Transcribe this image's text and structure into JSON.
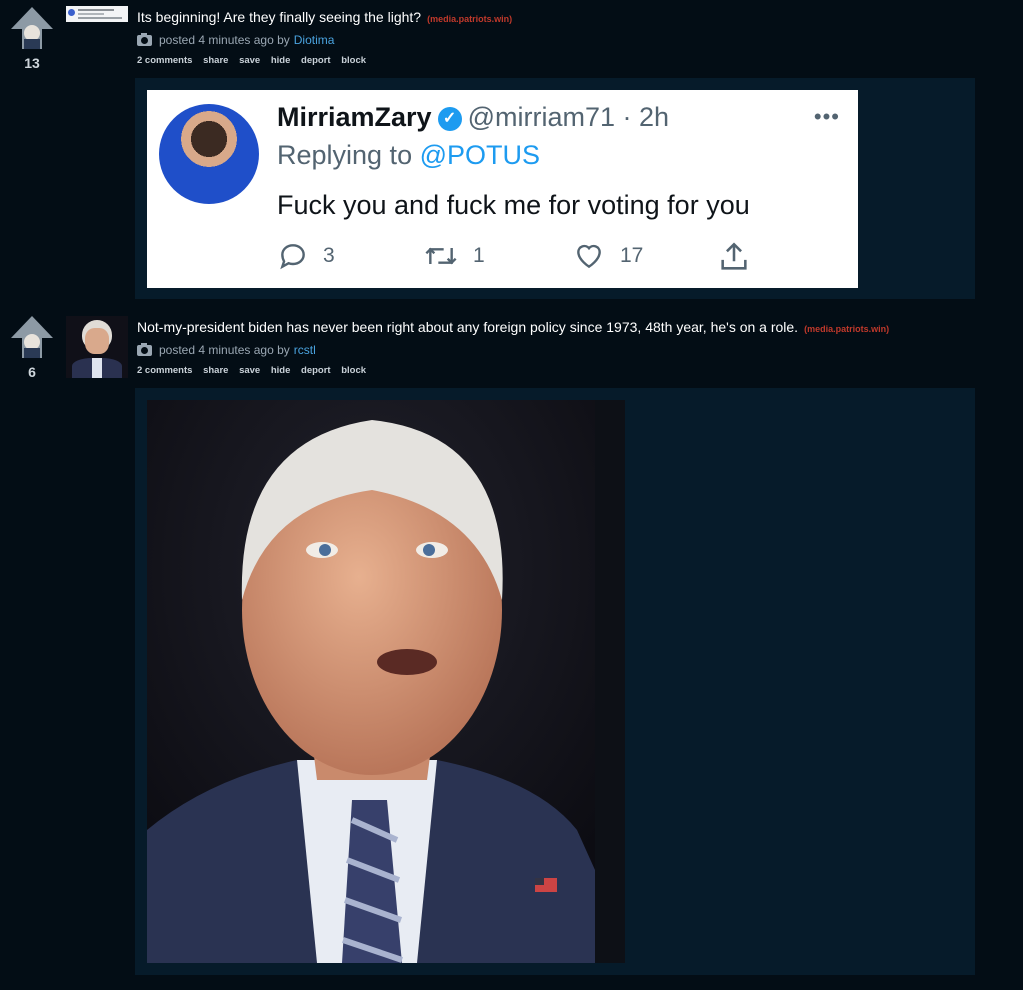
{
  "posts": [
    {
      "score": "13",
      "title": "Its beginning! Are they finally seeing the light?",
      "domain": "(media.patriots.win)",
      "posted": "posted 4 minutes ago by",
      "author": "Diotima",
      "actions": [
        "2 comments",
        "share",
        "save",
        "hide",
        "deport",
        "block"
      ],
      "tweet": {
        "name": "MirriamZary",
        "verified_icon": "verified-check-icon",
        "handle": "@mirriam71 · 2h",
        "more": "•••",
        "replying_to": "Replying to",
        "mention": "@POTUS",
        "body": "Fuck you and fuck me for voting for you",
        "reply_count": "3",
        "retweet_count": "1",
        "like_count": "17"
      }
    },
    {
      "score": "6",
      "title": "Not-my-president biden has never been right about any foreign policy since 1973, 48th year, he's on a role.",
      "domain": "(media.patriots.win)",
      "posted": "posted 4 minutes ago by",
      "author": "rcstl",
      "actions": [
        "2 comments",
        "share",
        "save",
        "hide",
        "deport",
        "block"
      ]
    }
  ],
  "colors": {
    "background": "#030d15",
    "media_box": "#061b2a",
    "domain": "#c0392b",
    "link": "#4aa3df",
    "twitter_blue": "#1d9bf0"
  }
}
